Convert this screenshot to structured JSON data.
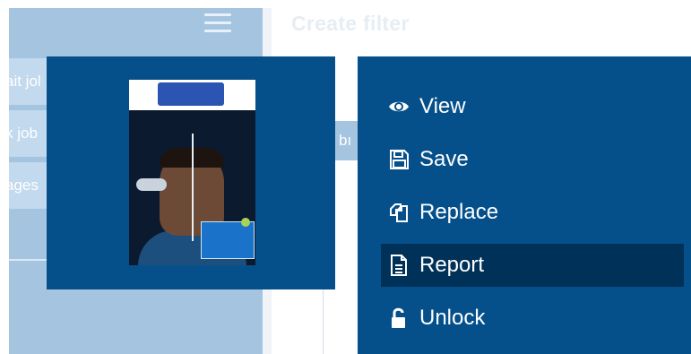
{
  "header": {
    "title": "Create filter"
  },
  "sidebar": {
    "items": [
      {
        "label": "ait jol"
      },
      {
        "label": "k job"
      },
      {
        "label": "ages"
      }
    ]
  },
  "background": {
    "pill_text": "bı"
  },
  "preview": {
    "logo": "",
    "tagline": "",
    "headline": ""
  },
  "menu": {
    "items": [
      {
        "label": "View",
        "icon": "eye-icon"
      },
      {
        "label": "Save",
        "icon": "floppy-disk-icon"
      },
      {
        "label": "Replace",
        "icon": "replace-icon"
      },
      {
        "label": "Report",
        "icon": "report-document-icon",
        "active": true
      },
      {
        "label": "Unlock",
        "icon": "unlock-icon"
      }
    ]
  },
  "colors": {
    "panel": "#05508a",
    "active_item": "#003259",
    "sidebar": "#a4c4e0",
    "text": "#ffffff"
  }
}
